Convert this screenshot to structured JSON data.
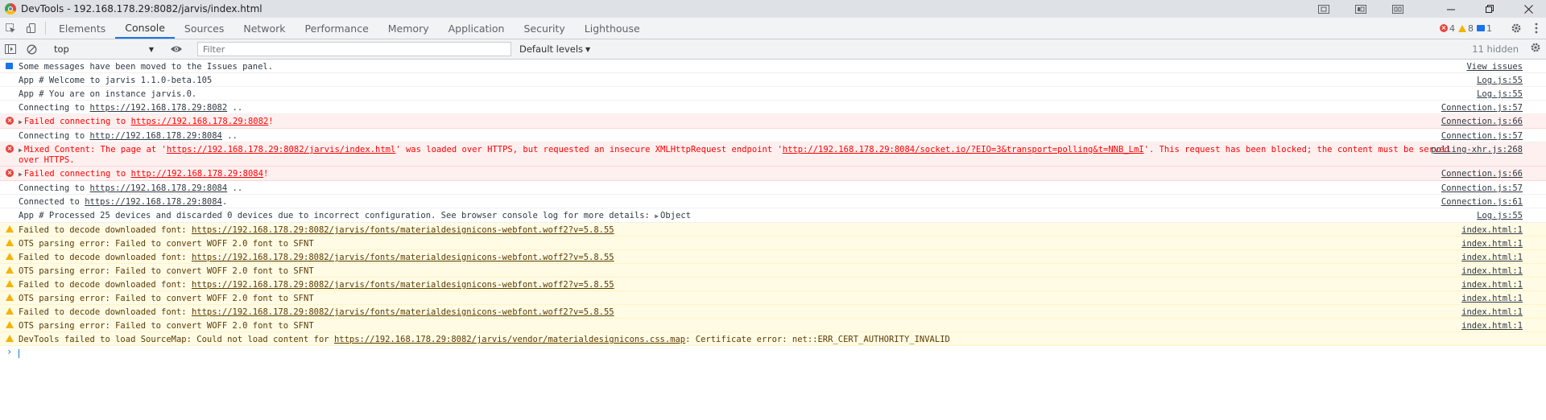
{
  "window": {
    "title": "DevTools - 192.168.178.29:8082/jarvis/index.html"
  },
  "tabs": [
    "Elements",
    "Console",
    "Sources",
    "Network",
    "Performance",
    "Memory",
    "Application",
    "Security",
    "Lighthouse"
  ],
  "active_tab": "Console",
  "counters": {
    "errors": "4",
    "warnings": "8",
    "messages": "1"
  },
  "toolbar": {
    "context": "top",
    "filter_placeholder": "Filter",
    "levels": "Default levels",
    "hidden": "11 hidden"
  },
  "messages": [
    {
      "type": "info",
      "icon": "note",
      "segments": [
        {
          "t": "Some messages have been moved to the Issues panel."
        }
      ],
      "source": "View issues"
    },
    {
      "type": "log",
      "segments": [
        {
          "t": "App # Welcome to jarvis 1.1.0-beta.105"
        }
      ],
      "source": "Log.js:55"
    },
    {
      "type": "log",
      "segments": [
        {
          "t": "App # You are on instance jarvis.0."
        }
      ],
      "source": "Log.js:55"
    },
    {
      "type": "log",
      "segments": [
        {
          "t": "Connecting to "
        },
        {
          "t": "https://192.168.178.29:8082",
          "link": true
        },
        {
          "t": " .."
        }
      ],
      "source": "Connection.js:57"
    },
    {
      "type": "error",
      "expand": true,
      "segments": [
        {
          "t": "Failed connecting to "
        },
        {
          "t": "https://192.168.178.29:8082",
          "link": true
        },
        {
          "t": "!"
        }
      ],
      "source": "Connection.js:66"
    },
    {
      "type": "log",
      "segments": [
        {
          "t": "Connecting to "
        },
        {
          "t": "http://192.168.178.29:8084",
          "link": true
        },
        {
          "t": " .."
        }
      ],
      "source": "Connection.js:57"
    },
    {
      "type": "error",
      "expand": true,
      "wrap": true,
      "segments": [
        {
          "t": "Mixed Content: The page at '"
        },
        {
          "t": "https://192.168.178.29:8082/jarvis/index.html",
          "link": true
        },
        {
          "t": "' was loaded over HTTPS, but requested an insecure XMLHttpRequest endpoint '"
        },
        {
          "t": "http://192.168.178.29:8084/socket.io/?EIO=3&transport=polling&t=NNB_LmI",
          "link": true
        },
        {
          "t": "'. This request has been blocked; the content must be served over HTTPS."
        }
      ],
      "source": "polling-xhr.js:268"
    },
    {
      "type": "error",
      "expand": true,
      "segments": [
        {
          "t": "Failed connecting to "
        },
        {
          "t": "http://192.168.178.29:8084",
          "link": true
        },
        {
          "t": "!"
        }
      ],
      "source": "Connection.js:66"
    },
    {
      "type": "log",
      "segments": [
        {
          "t": "Connecting to "
        },
        {
          "t": "https://192.168.178.29:8084",
          "link": true
        },
        {
          "t": " .."
        }
      ],
      "source": "Connection.js:57"
    },
    {
      "type": "log",
      "segments": [
        {
          "t": "Connected to "
        },
        {
          "t": "https://192.168.178.29:8084",
          "link": true
        },
        {
          "t": "."
        }
      ],
      "source": "Connection.js:61"
    },
    {
      "type": "log",
      "segments": [
        {
          "t": "App # Processed 25 devices and discarded 0 devices due to incorrect configuration. See browser console log for more details:  "
        },
        {
          "t": "Object",
          "object": true
        }
      ],
      "source": "Log.js:55"
    },
    {
      "type": "warning",
      "segments": [
        {
          "t": "Failed to decode downloaded font: "
        },
        {
          "t": "https://192.168.178.29:8082/jarvis/fonts/materialdesignicons-webfont.woff2?v=5.8.55",
          "link": true
        }
      ],
      "source": "index.html:1"
    },
    {
      "type": "warning",
      "segments": [
        {
          "t": "OTS parsing error: Failed to convert WOFF 2.0 font to SFNT"
        }
      ],
      "source": "index.html:1"
    },
    {
      "type": "warning",
      "segments": [
        {
          "t": "Failed to decode downloaded font: "
        },
        {
          "t": "https://192.168.178.29:8082/jarvis/fonts/materialdesignicons-webfont.woff2?v=5.8.55",
          "link": true
        }
      ],
      "source": "index.html:1"
    },
    {
      "type": "warning",
      "segments": [
        {
          "t": "OTS parsing error: Failed to convert WOFF 2.0 font to SFNT"
        }
      ],
      "source": "index.html:1"
    },
    {
      "type": "warning",
      "segments": [
        {
          "t": "Failed to decode downloaded font: "
        },
        {
          "t": "https://192.168.178.29:8082/jarvis/fonts/materialdesignicons-webfont.woff2?v=5.8.55",
          "link": true
        }
      ],
      "source": "index.html:1"
    },
    {
      "type": "warning",
      "segments": [
        {
          "t": "OTS parsing error: Failed to convert WOFF 2.0 font to SFNT"
        }
      ],
      "source": "index.html:1"
    },
    {
      "type": "warning",
      "segments": [
        {
          "t": "Failed to decode downloaded font: "
        },
        {
          "t": "https://192.168.178.29:8082/jarvis/fonts/materialdesignicons-webfont.woff2?v=5.8.55",
          "link": true
        }
      ],
      "source": "index.html:1"
    },
    {
      "type": "warning",
      "segments": [
        {
          "t": "OTS parsing error: Failed to convert WOFF 2.0 font to SFNT"
        }
      ],
      "source": "index.html:1"
    },
    {
      "type": "warning",
      "segments": [
        {
          "t": "DevTools failed to load SourceMap: Could not load content for "
        },
        {
          "t": "https://192.168.178.29:8082/jarvis/vendor/materialdesignicons.css.map",
          "link": true
        },
        {
          "t": ": Certificate error: net::ERR_CERT_AUTHORITY_INVALID"
        }
      ],
      "source": ""
    }
  ]
}
